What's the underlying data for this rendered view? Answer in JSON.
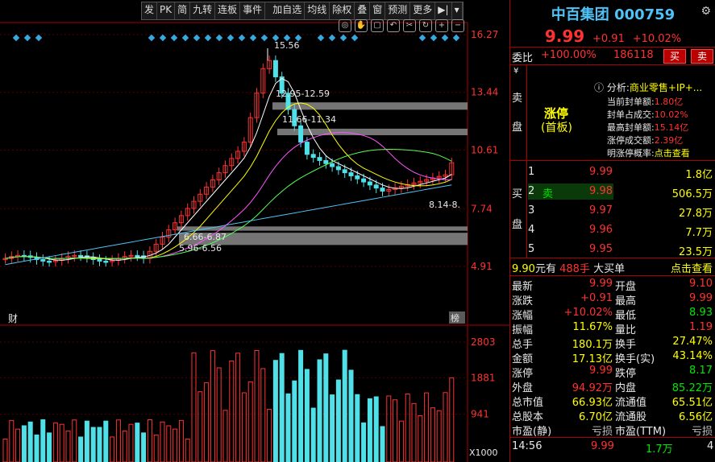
{
  "toolbar": {
    "items": [
      "发",
      "PK",
      "简",
      "九转",
      "连板",
      "事件",
      "加自选",
      "均线",
      "除权",
      "叠",
      "窗",
      "预测",
      "更多"
    ]
  },
  "stock": {
    "name": "中百集团",
    "code": "000759",
    "price": "9.99",
    "change": "+0.91",
    "change_pct": "+10.02%"
  },
  "weibi": {
    "label": "委比",
    "value": "+100.00%",
    "volume": "186118",
    "buy": "买",
    "sell": "卖"
  },
  "sell_side": {
    "label1": "卖",
    "label2": "盘"
  },
  "limit_up": {
    "title": "涨停",
    "sub": "(首板)"
  },
  "analysis": {
    "label": "分析:",
    "value": "商业零售+IP+...",
    "rows": [
      {
        "k": "当前封单额:",
        "v": "1.80亿"
      },
      {
        "k": "封单占成交:",
        "v": "10.02%"
      },
      {
        "k": "最高封单额:",
        "v": "15.14亿"
      },
      {
        "k": "涨停成交额:",
        "v": "2.39亿"
      },
      {
        "k": "明涨停概率:",
        "v": "点击查看"
      }
    ]
  },
  "buy_side": {
    "label1": "买",
    "label2": "盘"
  },
  "bids": [
    {
      "n": "1",
      "tag": "",
      "price": "9.99",
      "vol": "1.8亿"
    },
    {
      "n": "2",
      "tag": "卖",
      "price": "9.98",
      "vol": "506.5万"
    },
    {
      "n": "3",
      "tag": "",
      "price": "9.97",
      "vol": "27.8万"
    },
    {
      "n": "4",
      "tag": "",
      "price": "9.96",
      "vol": "7.7万"
    },
    {
      "n": "5",
      "tag": "",
      "price": "9.95",
      "vol": "23.5万"
    }
  ],
  "big_order": {
    "price": "9.90",
    "unit": "元有",
    "hands": "488手",
    "label": "大买单",
    "link": "点击查看"
  },
  "quotes": [
    {
      "k1": "最新",
      "v1": "9.99",
      "c1": "red",
      "k2": "开盘",
      "v2": "9.10",
      "c2": "red"
    },
    {
      "k1": "涨跌",
      "v1": "+0.91",
      "c1": "red",
      "k2": "最高",
      "v2": "9.99",
      "c2": "red"
    },
    {
      "k1": "涨幅",
      "v1": "+10.02%",
      "c1": "red",
      "k2": "最低",
      "v2": "8.93",
      "c2": "green"
    },
    {
      "k1": "振幅",
      "v1": "11.67%",
      "c1": "yellow",
      "k2": "量比",
      "v2": "1.19",
      "c2": "red"
    },
    {
      "k1": "总手",
      "v1": "180.1万",
      "c1": "yellow",
      "k2": "换手",
      "v2": "27.47%",
      "c2": "yellow"
    },
    {
      "k1": "金额",
      "v1": "17.13亿",
      "c1": "yellow",
      "k2": "换手(实)",
      "v2": "43.14%",
      "c2": "yellow"
    },
    {
      "k1": "涨停",
      "v1": "9.99",
      "c1": "red",
      "k2": "跌停",
      "v2": "8.17",
      "c2": "green"
    },
    {
      "k1": "外盘",
      "v1": "94.92万",
      "c1": "red",
      "k2": "内盘",
      "v2": "85.22万",
      "c2": "green"
    },
    {
      "k1": "总市值",
      "v1": "66.93亿",
      "c1": "yellow",
      "k2": "流通值",
      "v2": "65.51亿",
      "c2": "yellow"
    },
    {
      "k1": "总股本",
      "v1": "6.70亿",
      "c1": "yellow",
      "k2": "流通股",
      "v2": "6.56亿",
      "c2": "yellow"
    },
    {
      "k1": "市盈(静)",
      "v1": "亏损",
      "c1": "gray",
      "k2": "市盈(TTM)",
      "v2": "亏损",
      "c2": "gray"
    }
  ],
  "tick": {
    "time": "14:56",
    "price": "9.99",
    "vol": "1.7万",
    "num": "4"
  },
  "chart_data": {
    "type": "candlestick",
    "price_axis": {
      "ticks": [
        "16.27",
        "13.44",
        "10.61",
        "7.74",
        "4.91"
      ]
    },
    "volume_axis": {
      "ticks": [
        "2803",
        "1881",
        "941"
      ],
      "unit": "X1000"
    },
    "annotations": [
      "15.56",
      "12.95-12.59",
      "11.66-11.34",
      "8.14-8.",
      "6.66-6.87",
      "5.96-6.56"
    ],
    "labels": {
      "left_bottom": "财",
      "right_bottom": "榜"
    },
    "gap_zones": [
      [
        12.59,
        12.95
      ],
      [
        11.34,
        11.66
      ],
      [
        6.66,
        6.87
      ],
      [
        5.96,
        6.56
      ]
    ],
    "last_close": 9.99
  }
}
